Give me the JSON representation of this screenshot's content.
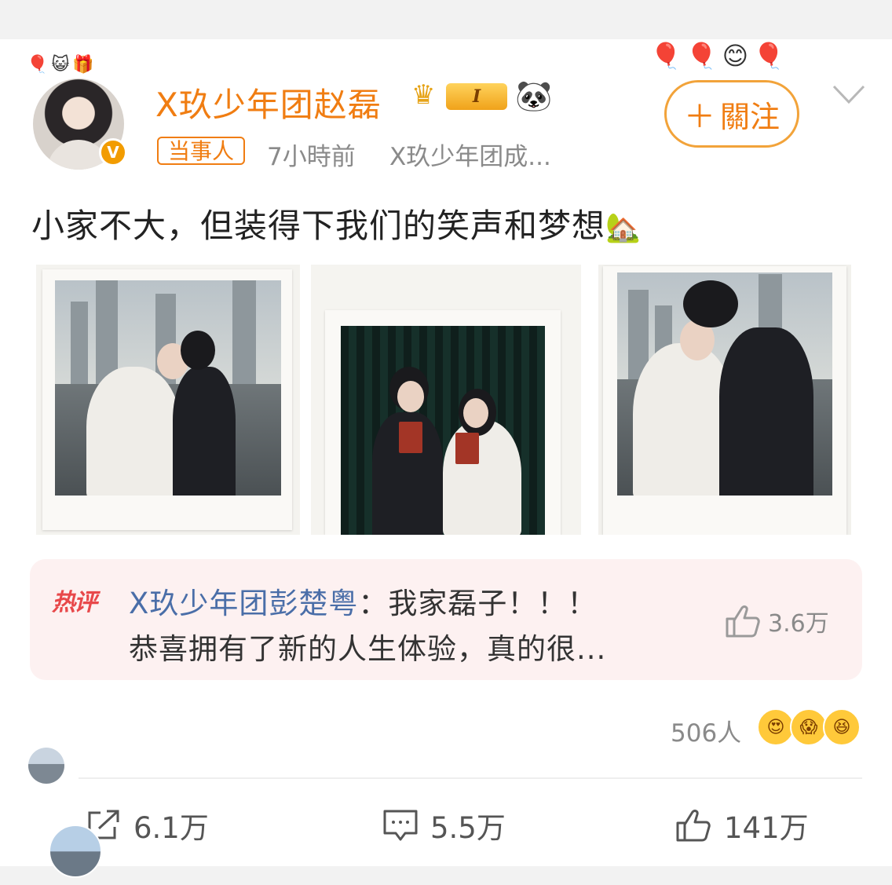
{
  "post": {
    "author": "X玖少年团赵磊",
    "level_badge": "I",
    "tag": "当事人",
    "time": "7小時前",
    "source": "X玖少年团成...",
    "follow_label": "關注",
    "text": "小家不大，但装得下我们的笑声和梦想",
    "accent_color": "#f07d12"
  },
  "hot_comment": {
    "badge": "热评",
    "author": "X玖少年团彭楚粤",
    "separator": "：",
    "line1": "我家磊子！！！",
    "line2": "恭喜拥有了新的人生体验，真的很...",
    "likes": "3.6万"
  },
  "reactions": {
    "count": "506人"
  },
  "actions": {
    "share": "6.1万",
    "comment": "5.5万",
    "like": "141万"
  }
}
